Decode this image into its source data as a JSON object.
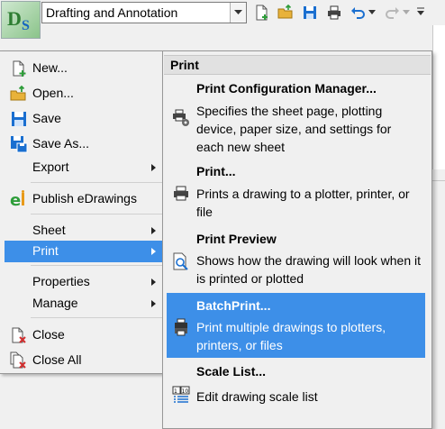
{
  "toolbar": {
    "workspace_value": "Drafting and Annotation"
  },
  "menu": {
    "new": "New...",
    "open": "Open...",
    "save": "Save",
    "save_as": "Save As...",
    "export": "Export",
    "publish": "Publish eDrawings",
    "sheet": "Sheet",
    "print": "Print",
    "properties": "Properties",
    "manage": "Manage",
    "close": "Close",
    "close_all": "Close All"
  },
  "submenu": {
    "header": "Print",
    "items": [
      {
        "title": "Print Configuration Manager...",
        "desc": "Specifies the sheet page, plotting device, paper size, and settings for each new sheet"
      },
      {
        "title": "Print...",
        "desc": "Prints a drawing to a plotter, printer, or file"
      },
      {
        "title": "Print Preview",
        "desc": "Shows how the drawing will look when it is printed or plotted"
      },
      {
        "title": "BatchPrint...",
        "desc": "Print multiple drawings to plotters, printers, or files"
      },
      {
        "title": "Scale List...",
        "desc": "Edit drawing scale list"
      }
    ]
  },
  "colors": {
    "highlight": "#3d8fe8",
    "menu_bg": "#f0f0f0"
  }
}
